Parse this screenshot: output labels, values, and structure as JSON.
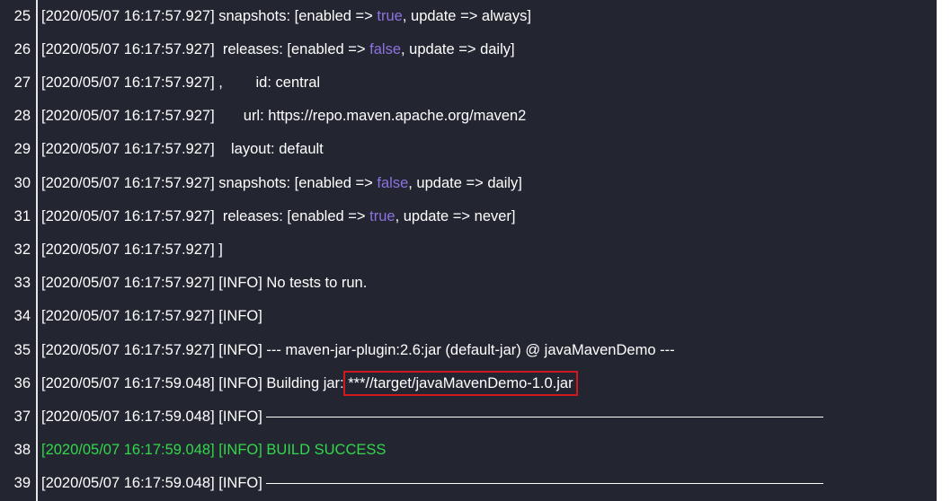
{
  "colors": {
    "background": "#232631",
    "text": "#ffffff",
    "keyword": "#8d72e0",
    "success": "#32d74b",
    "highlight_border": "#d0191e"
  },
  "lines": [
    {
      "n": "25",
      "parts": [
        {
          "t": "[2020/05/07 16:17:57.927] snapshots: [enabled => "
        },
        {
          "t": "true",
          "c": "kw"
        },
        {
          "t": ", update => always]"
        }
      ]
    },
    {
      "n": "26",
      "parts": [
        {
          "t": "[2020/05/07 16:17:57.927]  releases: [enabled => "
        },
        {
          "t": "false",
          "c": "kw"
        },
        {
          "t": ", update => daily]"
        }
      ]
    },
    {
      "n": "27",
      "parts": [
        {
          "t": "[2020/05/07 16:17:57.927] ,        id: central"
        }
      ]
    },
    {
      "n": "28",
      "parts": [
        {
          "t": "[2020/05/07 16:17:57.927]       url: https://repo.maven.apache.org/maven2"
        }
      ]
    },
    {
      "n": "29",
      "parts": [
        {
          "t": "[2020/05/07 16:17:57.927]    layout: default"
        }
      ]
    },
    {
      "n": "30",
      "parts": [
        {
          "t": "[2020/05/07 16:17:57.927] snapshots: [enabled => "
        },
        {
          "t": "false",
          "c": "kw"
        },
        {
          "t": ", update => daily]"
        }
      ]
    },
    {
      "n": "31",
      "parts": [
        {
          "t": "[2020/05/07 16:17:57.927]  releases: [enabled => "
        },
        {
          "t": "true",
          "c": "kw"
        },
        {
          "t": ", update => never]"
        }
      ]
    },
    {
      "n": "32",
      "parts": [
        {
          "t": "[2020/05/07 16:17:57.927] ]"
        }
      ]
    },
    {
      "n": "33",
      "parts": [
        {
          "t": "[2020/05/07 16:17:57.927] [INFO] No tests to run."
        }
      ]
    },
    {
      "n": "34",
      "parts": [
        {
          "t": "[2020/05/07 16:17:57.927] [INFO]"
        }
      ]
    },
    {
      "n": "35",
      "parts": [
        {
          "t": "[2020/05/07 16:17:57.927] [INFO] --- maven-jar-plugin:2.6:jar (default-jar) @ javaMavenDemo ---"
        }
      ]
    },
    {
      "n": "36",
      "parts": [
        {
          "t": "[2020/05/07 16:17:59.048] [INFO] Building jar: "
        },
        {
          "t": "***//target/javaMavenDemo-1.0.jar",
          "c": "hl"
        }
      ]
    },
    {
      "n": "37",
      "parts": [
        {
          "t": "[2020/05/07 16:17:59.048] [INFO] "
        },
        {
          "dash": true
        }
      ]
    },
    {
      "n": "38",
      "parts": [
        {
          "t": "[2020/05/07 16:17:59.048] [INFO] BUILD SUCCESS",
          "c": "ok"
        }
      ]
    },
    {
      "n": "39",
      "parts": [
        {
          "t": "[2020/05/07 16:17:59.048] [INFO] "
        },
        {
          "dash": true
        }
      ]
    }
  ]
}
